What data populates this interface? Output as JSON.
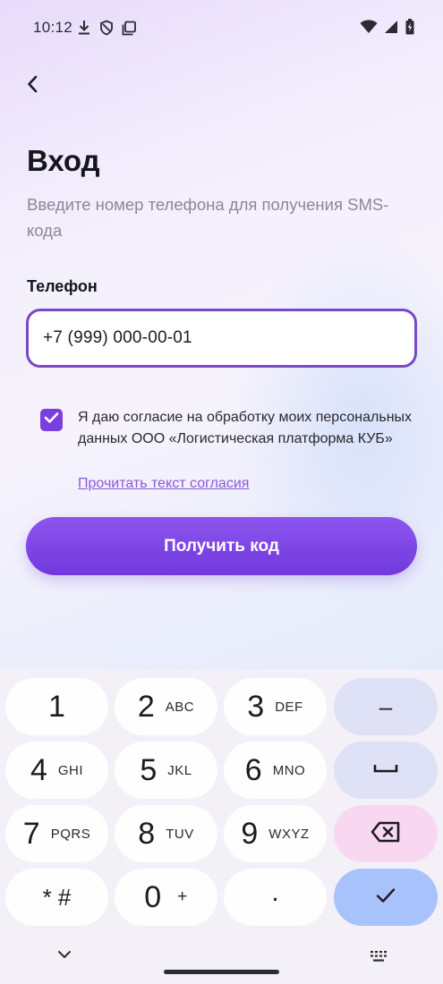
{
  "status_bar": {
    "time": "10:12",
    "left_icons": [
      "download-icon",
      "shield-icon",
      "screenshot-icon"
    ],
    "right_icons": [
      "wifi-icon",
      "signal-icon",
      "battery-charging-icon"
    ]
  },
  "header": {
    "back_icon": "chevron-left-icon"
  },
  "login": {
    "title": "Вход",
    "subtitle": "Введите номер телефона для получения SMS-кода",
    "phone_label": "Телефон",
    "phone_value": "+7 (999) 000-00-01",
    "consent_checked": true,
    "consent_text": "Я даю согласие на обработку моих персональных данных ООО «Логистическая платформа КУБ»",
    "consent_link": "Прочитать текст согласия",
    "submit_label": "Получить код"
  },
  "keyboard": {
    "keys": [
      {
        "digit": "1",
        "letters": ""
      },
      {
        "digit": "2",
        "letters": "ABC"
      },
      {
        "digit": "3",
        "letters": "DEF"
      },
      {
        "digit": "4",
        "letters": "GHI"
      },
      {
        "digit": "5",
        "letters": "JKL"
      },
      {
        "digit": "6",
        "letters": "MNO"
      },
      {
        "digit": "7",
        "letters": "PQRS"
      },
      {
        "digit": "8",
        "letters": "TUV"
      },
      {
        "digit": "9",
        "letters": "WXYZ"
      },
      {
        "digit": "* #",
        "letters": ""
      },
      {
        "digit": "0",
        "letters": "+"
      },
      {
        "digit": ".",
        "letters": ""
      }
    ],
    "side_keys": {
      "minus": "–",
      "space_icon": "space-bar-icon",
      "backspace_icon": "backspace-icon",
      "done_icon": "checkmark-icon"
    }
  },
  "colors": {
    "accent": "#7a3fe0",
    "field_border": "#7a47c8",
    "link": "#8a5ad8",
    "subtitle": "#8b8798"
  }
}
